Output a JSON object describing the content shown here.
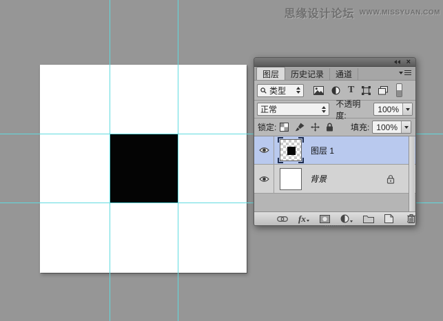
{
  "watermark": {
    "site_name": "思缘设计论坛",
    "site_url": "WWW.MISSYUAN.COM"
  },
  "panel": {
    "tabs": [
      {
        "label": "图层",
        "active": true
      },
      {
        "label": "历史记录",
        "active": false
      },
      {
        "label": "通道",
        "active": false
      }
    ],
    "filter_row": {
      "kind_value": "类型"
    },
    "blend_row": {
      "mode_value": "正常",
      "opacity_label": "不透明度:",
      "opacity_value": "100%"
    },
    "lock_row": {
      "lock_label": "锁定:",
      "fill_label": "填充:",
      "fill_value": "100%"
    },
    "layers": [
      {
        "name": "图层 1",
        "selected": true,
        "visible": true,
        "thumbnail": "transparent-checker-with-black-square"
      },
      {
        "name": "背景",
        "selected": false,
        "visible": true,
        "locked": true,
        "thumbnail": "white"
      }
    ],
    "bottom_bar": {
      "fx_label": "fx"
    }
  },
  "canvas": {
    "background": "#ffffff",
    "black_square_color": "#040404",
    "guide_color": "#5fdbdf",
    "grid": "3x3 via 2 vertical + 2 horizontal guides, black square fills center cell"
  },
  "colors": {
    "page_background": "#969696",
    "panel_background": "#b9b9b9",
    "selected_layer_row": "#b9c9ee",
    "guide": "#5fdbdf"
  }
}
